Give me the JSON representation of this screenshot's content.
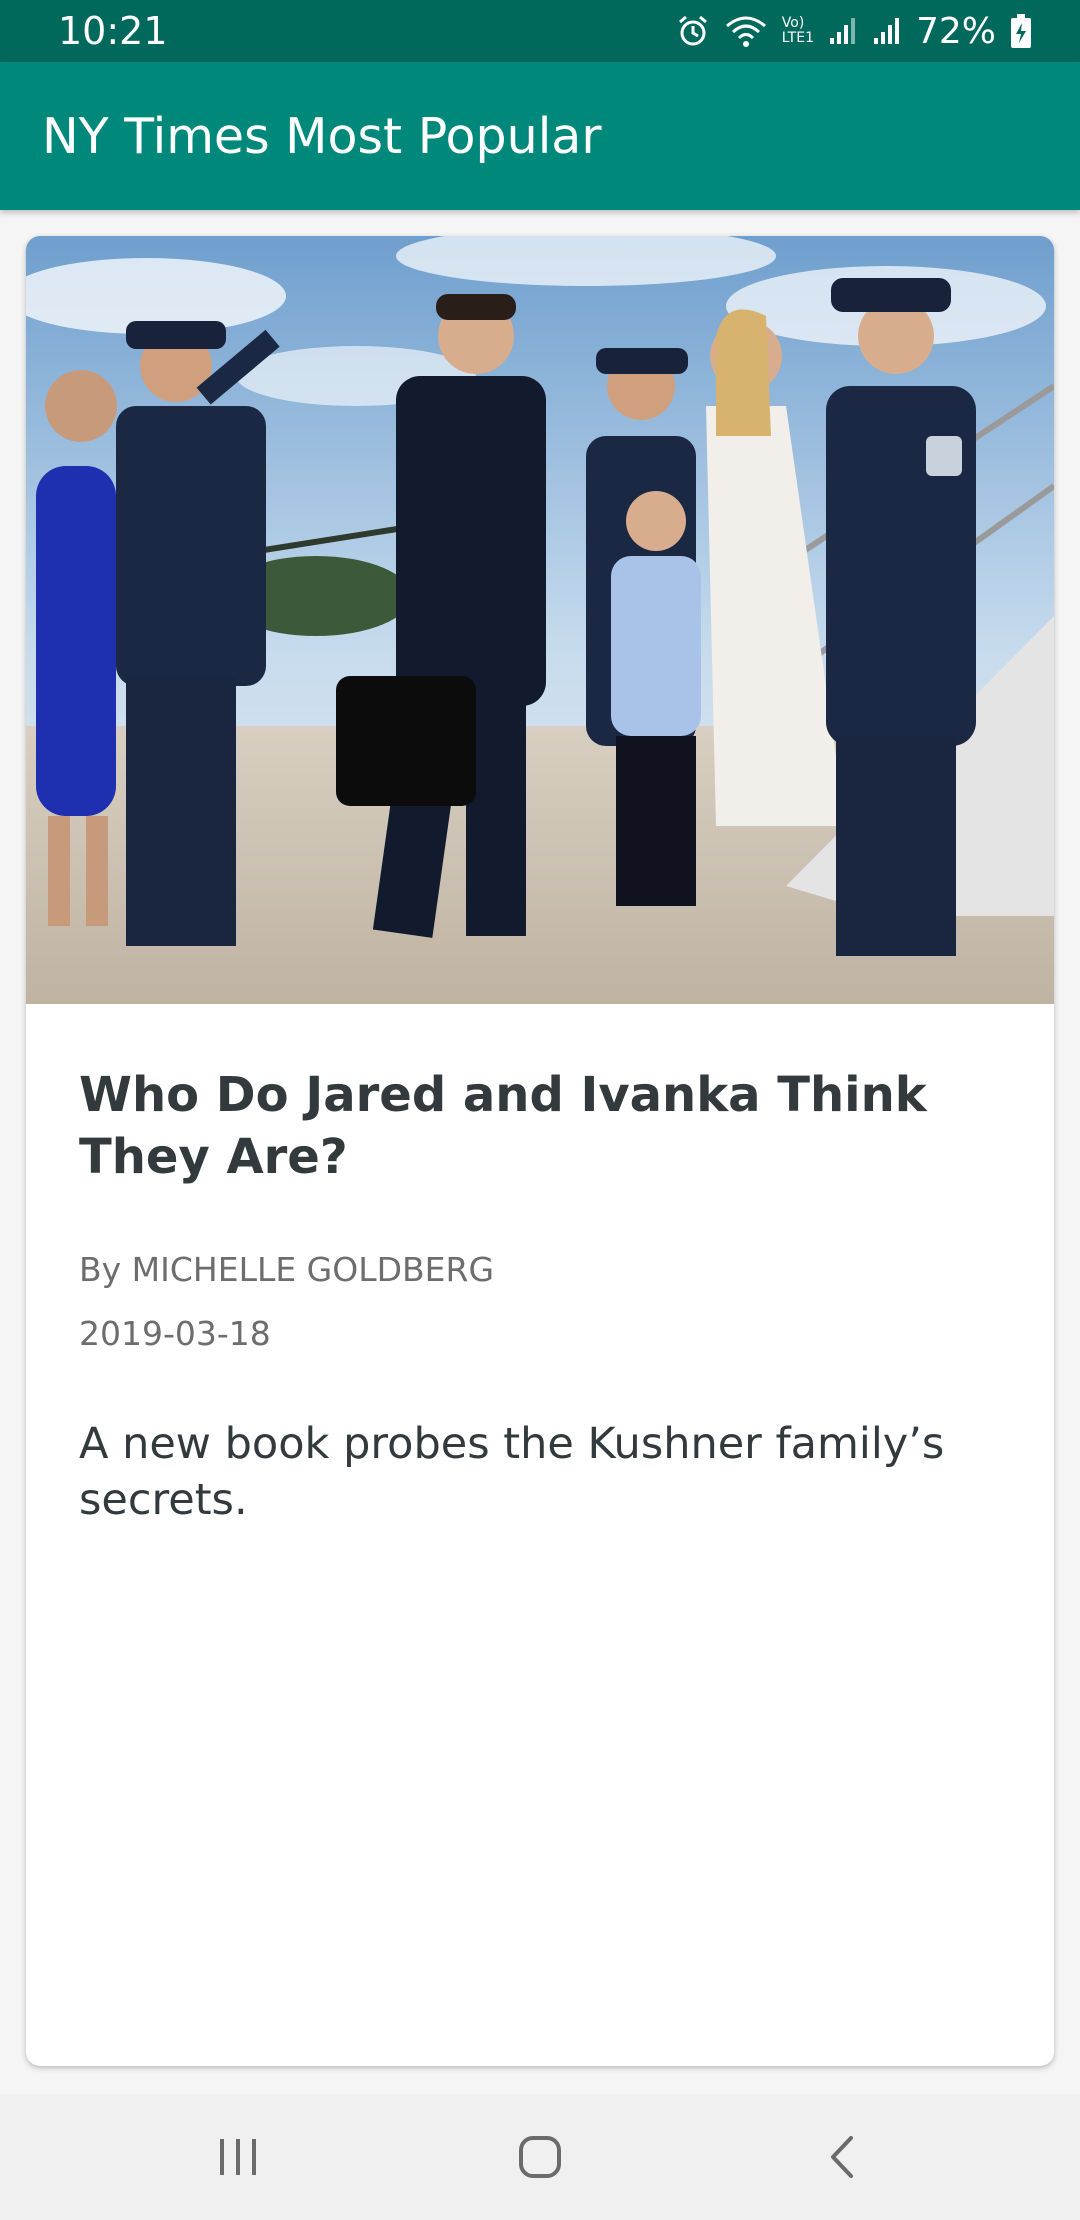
{
  "status_bar": {
    "time": "10:21",
    "battery_percent": "72%",
    "icons": [
      "alarm-icon",
      "wifi-icon",
      "volte-icon",
      "signal-icon",
      "signal-icon",
      "battery-charging-icon"
    ],
    "lte_label_top": "Vo)",
    "lte_label_bottom": "LTE1"
  },
  "app_bar": {
    "title": "NY Times Most Popular",
    "color": "#00897b",
    "status_color": "#00695c"
  },
  "article": {
    "image_icon": "article-photo",
    "title": "Who Do Jared and Ivanka Think They Are?",
    "byline": "By MICHELLE GOLDBERG",
    "date": "2019-03-18",
    "abstract": "A new book probes the Kushner family’s secrets."
  },
  "nav_bar": {
    "buttons": [
      "recent-apps-icon",
      "home-icon",
      "back-icon"
    ]
  }
}
